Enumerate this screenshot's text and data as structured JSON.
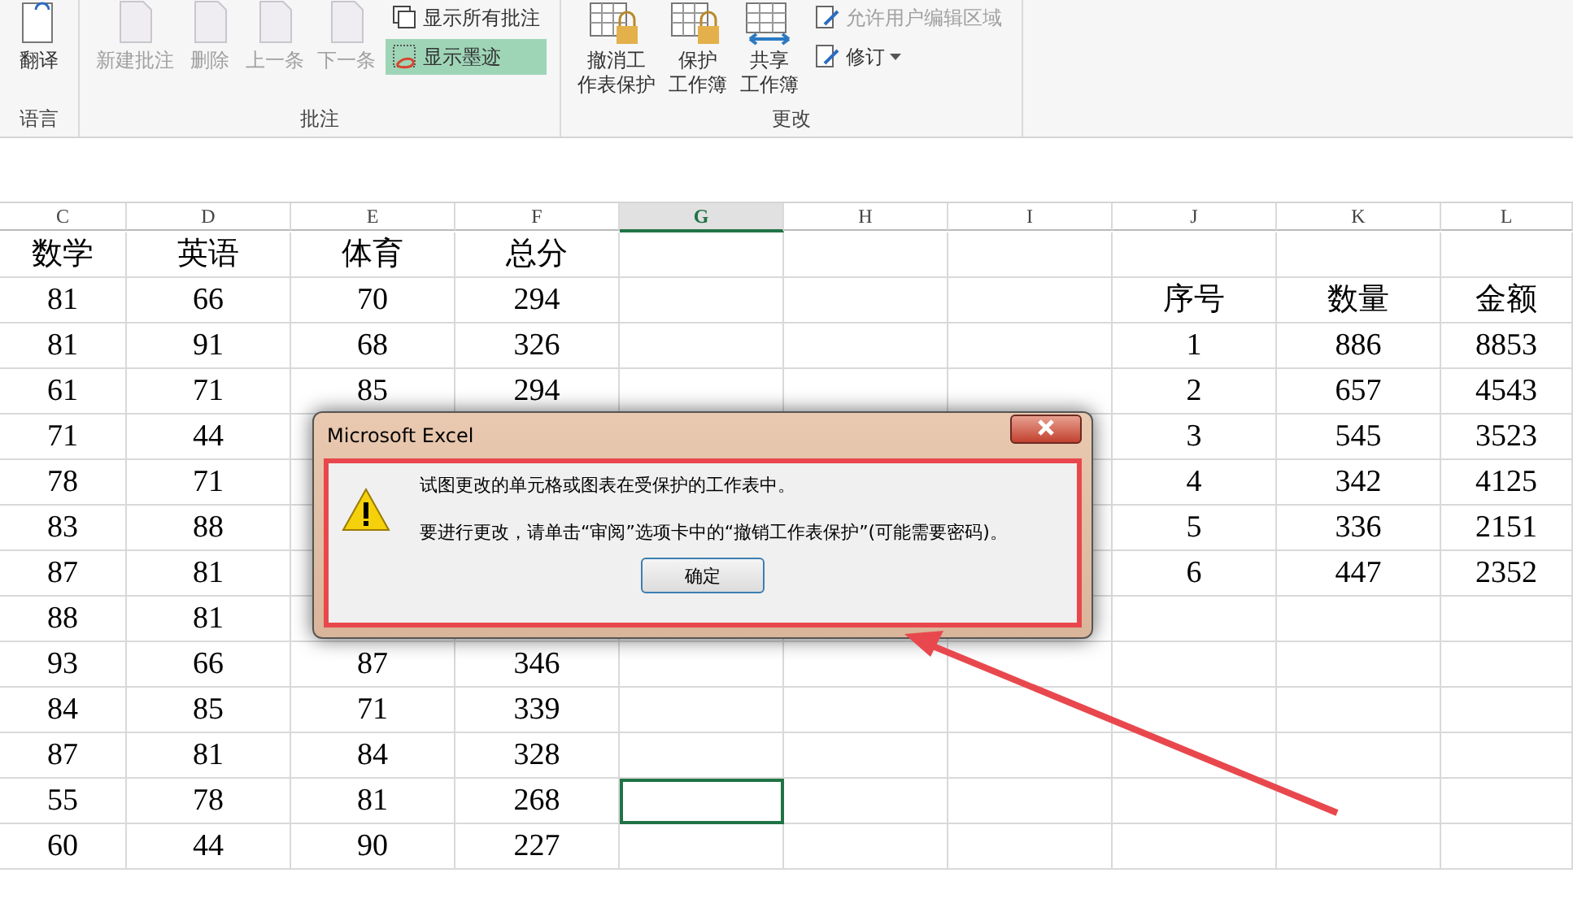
{
  "ribbon": {
    "groups": [
      {
        "label": "语言",
        "large_buttons": [
          {
            "lines": [
              "翻译"
            ],
            "disabled": false
          }
        ]
      },
      {
        "label": "批注",
        "large_buttons": [
          {
            "lines": [
              "新建批注"
            ],
            "disabled": true
          },
          {
            "lines": [
              "删除"
            ],
            "disabled": true
          },
          {
            "lines": [
              "上一条"
            ],
            "disabled": true
          },
          {
            "lines": [
              "下一条"
            ],
            "disabled": true
          }
        ],
        "small_buttons": [
          {
            "label": "显示所有批注",
            "disabled": false,
            "selected": false,
            "dropdown": false
          },
          {
            "label": "显示墨迹",
            "disabled": false,
            "selected": true,
            "dropdown": false
          }
        ]
      },
      {
        "label": "更改",
        "large_buttons": [
          {
            "lines": [
              "撤消工",
              "作表保护"
            ],
            "disabled": false
          },
          {
            "lines": [
              "保护",
              "工作簿"
            ],
            "disabled": false
          },
          {
            "lines": [
              "共享",
              "工作簿"
            ],
            "disabled": false
          }
        ],
        "small_buttons": [
          {
            "label": "允许用户编辑区域",
            "disabled": true,
            "selected": false,
            "dropdown": false
          },
          {
            "label": "修订",
            "disabled": false,
            "selected": false,
            "dropdown": true
          }
        ]
      }
    ]
  },
  "sheet": {
    "columns": [
      {
        "label": "C",
        "selected": false
      },
      {
        "label": "D",
        "selected": false
      },
      {
        "label": "E",
        "selected": false
      },
      {
        "label": "F",
        "selected": false
      },
      {
        "label": "G",
        "selected": true
      },
      {
        "label": "H",
        "selected": false
      },
      {
        "label": "I",
        "selected": false
      },
      {
        "label": "J",
        "selected": false
      },
      {
        "label": "K",
        "selected": false
      },
      {
        "label": "L",
        "selected": false
      }
    ],
    "rows": [
      {
        "c": "数学",
        "d": "英语",
        "e": "体育",
        "f": "总分",
        "g_selected": false
      },
      {
        "c": "81",
        "d": "66",
        "e": "70",
        "f": "294",
        "j": "序号",
        "k": "数量",
        "l": "金额",
        "g_selected": false
      },
      {
        "c": "81",
        "d": "91",
        "e": "68",
        "f": "326",
        "j": "1",
        "k": "886",
        "l": "8853",
        "g_selected": false
      },
      {
        "c": "61",
        "d": "71",
        "e": "85",
        "f": "294",
        "j": "2",
        "k": "657",
        "l": "4543",
        "g_selected": false
      },
      {
        "c": "71",
        "d": "44",
        "j": "3",
        "k": "545",
        "l": "3523"
      },
      {
        "c": "78",
        "d": "71",
        "j": "4",
        "k": "342",
        "l": "4125"
      },
      {
        "c": "83",
        "d": "88",
        "j": "5",
        "k": "336",
        "l": "2151"
      },
      {
        "c": "87",
        "d": "81",
        "j": "6",
        "k": "447",
        "l": "2352"
      },
      {
        "c": "88",
        "d": "81",
        "g_selected": false
      },
      {
        "c": "93",
        "d": "66",
        "e": "87",
        "f": "346",
        "g_selected": false
      },
      {
        "c": "84",
        "d": "85",
        "e": "71",
        "f": "339",
        "g_selected": false
      },
      {
        "c": "87",
        "d": "81",
        "e": "84",
        "f": "328",
        "g_selected": false
      },
      {
        "c": "55",
        "d": "78",
        "e": "81",
        "f": "268",
        "g_selected": true
      },
      {
        "c": "60",
        "d": "44",
        "e": "90",
        "f": "227",
        "g_selected": false
      }
    ]
  },
  "dialog": {
    "title": "Microsoft Excel",
    "messages": [
      "试图更改的单元格或图表在受保护的工作表中。",
      "要进行更改，请单击“审阅”选项卡中的“撤销工作表保护”(可能需要密码)。"
    ],
    "button": "确定"
  }
}
